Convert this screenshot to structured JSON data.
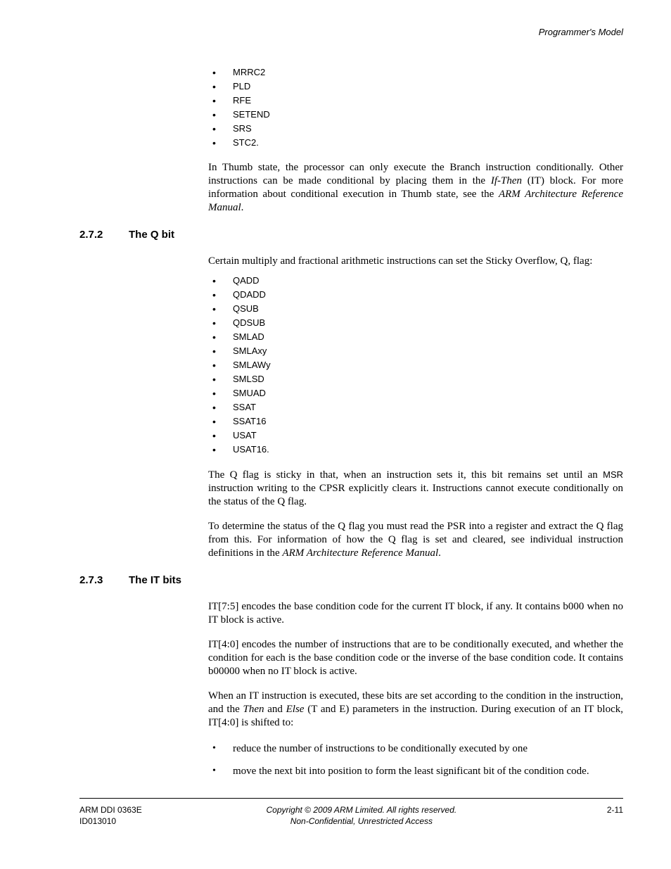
{
  "header": {
    "right": "Programmer's Model"
  },
  "intro_list": [
    "MRRC2",
    "PLD",
    "RFE",
    "SETEND",
    "SRS",
    "STC2."
  ],
  "p_thumb": {
    "t1": "In Thumb state, the processor can only execute the Branch instruction conditionally. Other instructions can be made conditional by placing them in the ",
    "i1": "If-Then",
    "t2": " (IT) block. For more information about conditional execution in Thumb state, see the ",
    "i2": "ARM Architecture Reference Manual",
    "t3": "."
  },
  "s272": {
    "num": "2.7.2",
    "title": "The Q bit",
    "intro": "Certain multiply and fractional arithmetic instructions can set the Sticky Overflow, Q, flag:",
    "list": [
      "QADD",
      "QDADD",
      "QSUB",
      "QDSUB",
      "SMLAD",
      "SMLAxy",
      "SMLAWy",
      "SMLSD",
      "SMUAD",
      "SSAT",
      "SSAT16",
      "USAT",
      "USAT16."
    ],
    "p2": {
      "t1": "The Q flag is sticky in that, when an instruction sets it, this bit remains set until an ",
      "m1": "MSR",
      "t2": " instruction writing to the CPSR explicitly clears it. Instructions cannot execute conditionally on the status of the Q flag."
    },
    "p3": {
      "t1": "To determine the status of the Q flag you must read the PSR into a register and extract the Q flag from this. For information of how the Q flag is set and cleared, see individual instruction definitions in the ",
      "i1": "ARM Architecture Reference Manual",
      "t2": "."
    }
  },
  "s273": {
    "num": "2.7.3",
    "title": "The IT bits",
    "p1": "IT[7:5] encodes the base condition code for the current IT block, if any. It contains b000 when no IT block is active.",
    "p2": "IT[4:0] encodes the number of instructions that are to be conditionally executed, and whether the condition for each is the base condition code or the inverse of the base condition code. It contains b00000 when no IT block is active.",
    "p3": {
      "t1": "When an IT instruction is executed, these bits are set according to the condition in the instruction, and the ",
      "i1": "Then",
      "t2": " and ",
      "i2": "Else",
      "t3": " (T and E) parameters in the instruction. During execution of an IT block, IT[4:0] is shifted to:"
    },
    "bullets": [
      "reduce the number of instructions to be conditionally executed by one",
      "move the next bit into position to form the least significant bit of the condition code."
    ]
  },
  "footer": {
    "left1": "ARM DDI 0363E",
    "left2": "ID013010",
    "center1": "Copyright © 2009 ARM Limited. All rights reserved.",
    "center2": "Non-Confidential, Unrestricted Access",
    "right": "2-11"
  }
}
